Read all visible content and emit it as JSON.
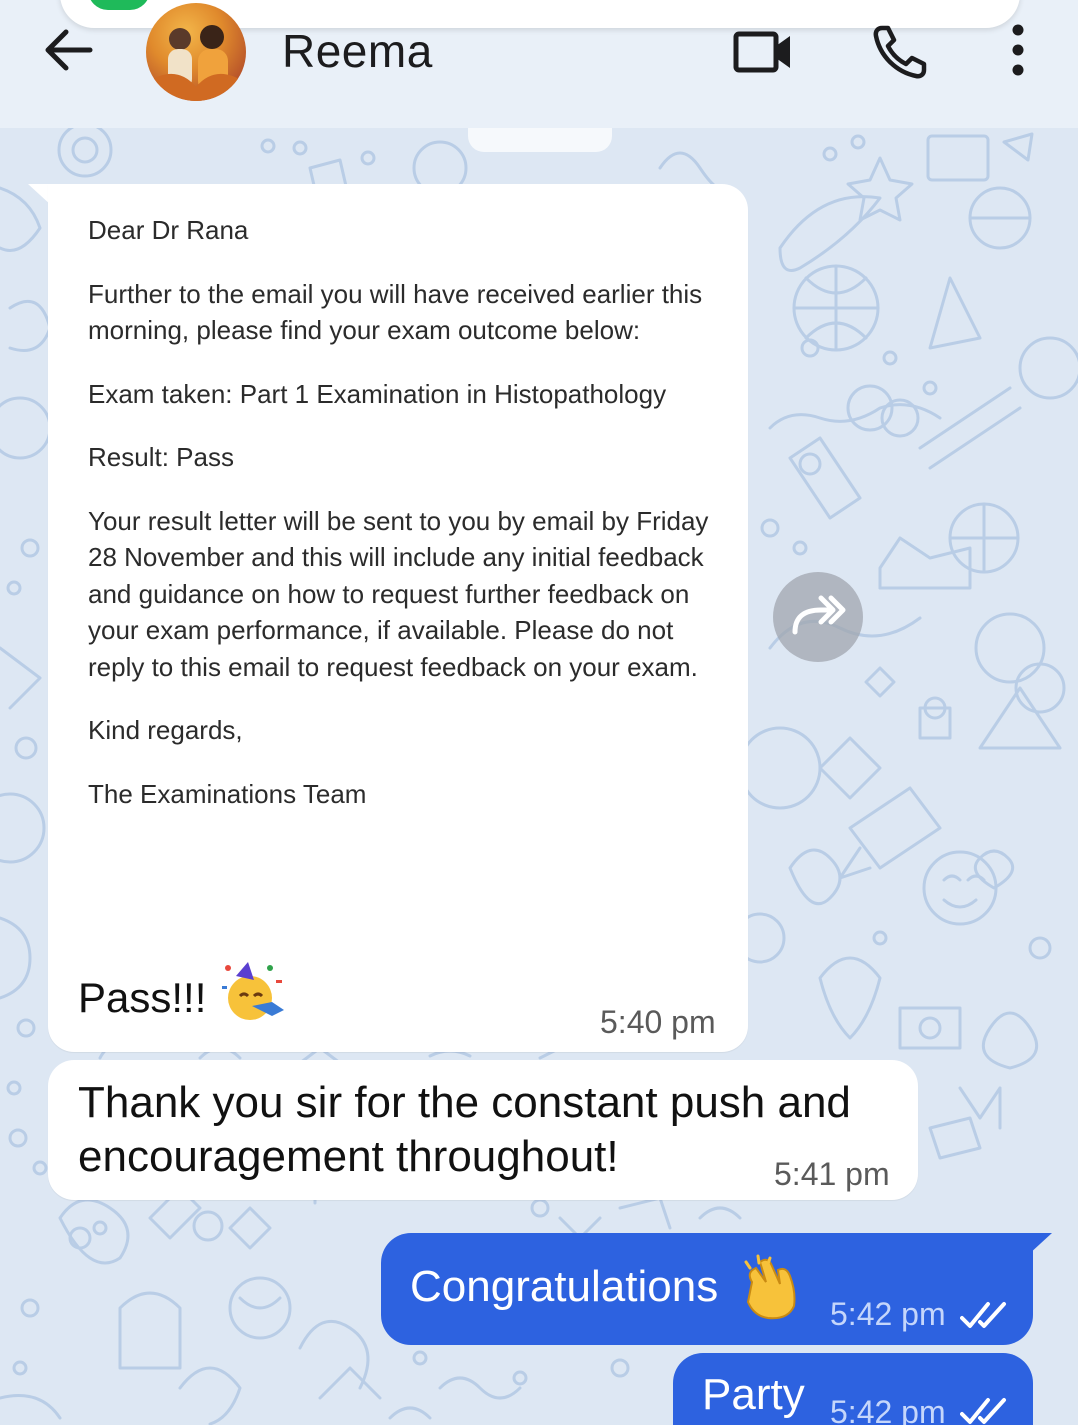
{
  "header": {
    "contact_name": "Reema",
    "back_icon": "arrow-left-icon",
    "video_icon": "video-camera-icon",
    "call_icon": "phone-icon",
    "menu_icon": "more-vertical-icon"
  },
  "messages": [
    {
      "direction": "incoming",
      "quoted_paragraphs": [
        "Dear Dr Rana",
        "Further to the email you will have received earlier this morning, please find your exam outcome below:",
        "Exam taken: Part 1 Examination in Histopathology",
        "Result: Pass",
        "Your result letter will be sent to you by email by Friday 28 November and this will include any initial feedback and guidance on how to request further feedback on your exam performance, if available. Please do not reply to this email to request feedback on your exam.",
        "Kind regards,",
        "The Examinations Team"
      ],
      "text": "Pass!!!",
      "emoji": "party-face-emoji",
      "time": "5:40 pm"
    },
    {
      "direction": "incoming",
      "text": "Thank you sir for the constant push and encouragement throughout!",
      "time": "5:41 pm"
    },
    {
      "direction": "outgoing",
      "text": "Congratulations",
      "emoji": "clapping-hands-emoji",
      "time": "5:42 pm",
      "status": "read-double-check"
    },
    {
      "direction": "outgoing",
      "text": "Party",
      "time": "5:42 pm",
      "status": "read-double-check"
    }
  ],
  "colors": {
    "header_bg": "#e9f0f8",
    "wallpaper_bg": "#dde7f3",
    "wallpaper_doodle": "#b9cde6",
    "incoming_bubble": "#ffffff",
    "outgoing_bubble": "#2d62e0",
    "outgoing_time": "#c5d6fb"
  }
}
